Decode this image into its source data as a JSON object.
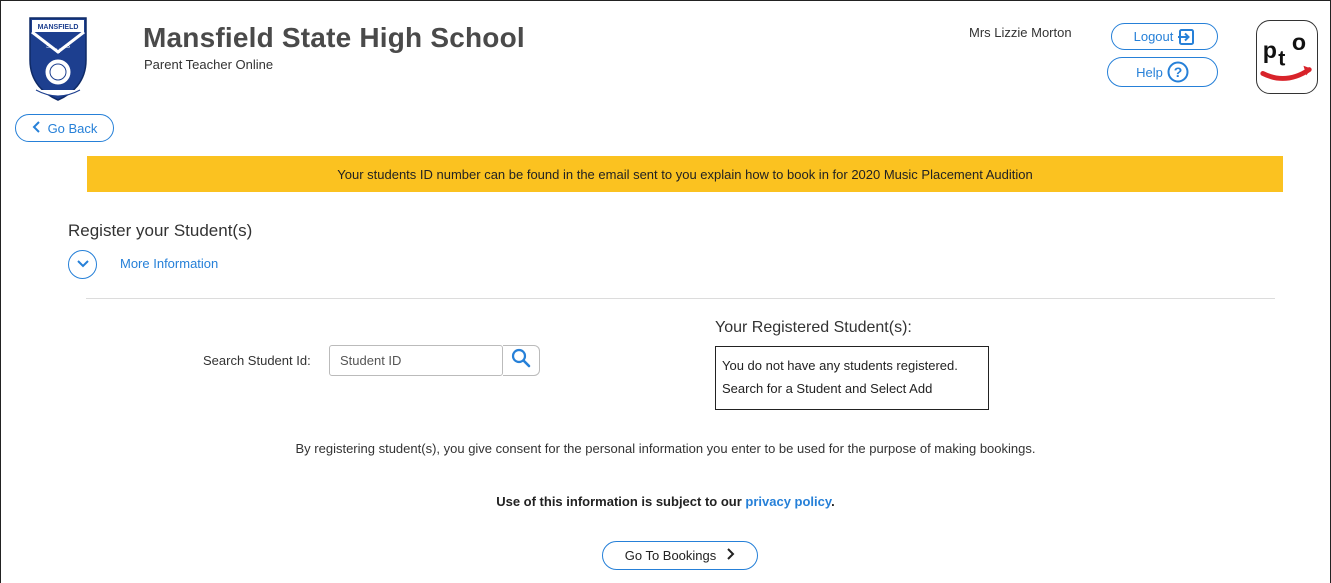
{
  "header": {
    "school_name": "Mansfield State High School",
    "subtitle": "Parent Teacher Online",
    "crest_text": "MANSFIELD",
    "user_name": "Mrs Lizzie Morton",
    "logout_label": "Logout",
    "help_label": "Help",
    "logo_text": "pto"
  },
  "nav": {
    "back_label": "Go Back"
  },
  "banner": {
    "text": "Your students ID number can be found in the email sent to you explain how to book in for 2020 Music Placement Audition",
    "color": "#fbc220"
  },
  "register": {
    "title": "Register your Student(s)",
    "more_info": "More Information"
  },
  "search": {
    "label": "Search Student Id:",
    "placeholder": "Student ID",
    "value": ""
  },
  "registered": {
    "heading": "Your Registered Student(s):",
    "line1": "You do not have any students registered.",
    "line2": "Search for a Student and Select Add"
  },
  "footer": {
    "consent": "By registering student(s), you give consent for the personal information you enter to be used for the purpose of making bookings.",
    "privacy_prefix": "Use of this information is subject to our",
    "privacy_link": "privacy policy",
    "privacy_suffix": ".",
    "bookings_label": "Go To Bookings"
  },
  "colors": {
    "accent": "#2680d8",
    "banner": "#fbc220",
    "logo_red": "#d8232a"
  },
  "icons": [
    "logout-icon",
    "help-icon",
    "chevron-left-icon",
    "chevron-down-icon",
    "search-icon",
    "chevron-right-icon"
  ]
}
